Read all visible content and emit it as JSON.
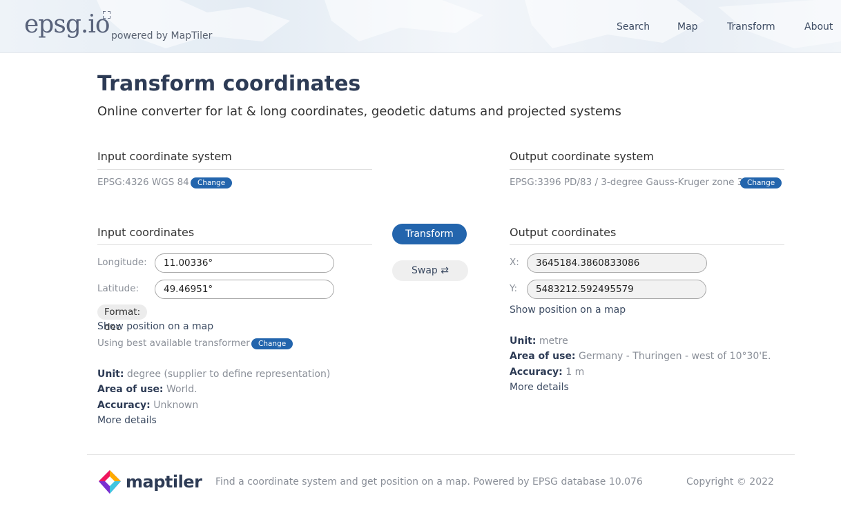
{
  "header": {
    "logo_text": "epsg.io",
    "powered_by": "powered by MapTiler",
    "nav": [
      "Search",
      "Map",
      "Transform",
      "About"
    ]
  },
  "main": {
    "title": "Transform coordinates",
    "subtitle": "Online converter for lat & long coordinates, geodetic datums and projected systems"
  },
  "input_system": {
    "heading": "Input coordinate system",
    "value": "EPSG:4326 WGS 84",
    "change_label": "Change"
  },
  "output_system": {
    "heading": "Output coordinate system",
    "value": "EPSG:3396 PD/83 / 3-degree Gauss-Kruger zone 3",
    "change_label": "Change"
  },
  "input_coords": {
    "heading": "Input coordinates",
    "longitude_label": "Longitude:",
    "longitude_value": "11.00336°",
    "latitude_label": "Latitude:",
    "latitude_value": "49.46951°",
    "format": "Format: dec",
    "show_map": "Show position on a map",
    "transformer": "Using best available transformer",
    "change_label": "Change",
    "unit_label": "Unit:",
    "unit_value": "degree (supplier to define representation)",
    "area_label": "Area of use:",
    "area_value": "World.",
    "accuracy_label": "Accuracy:",
    "accuracy_value": "Unknown",
    "more_details": "More details"
  },
  "actions": {
    "transform": "Transform",
    "swap": "Swap ⇄"
  },
  "output_coords": {
    "heading": "Output coordinates",
    "x_label": "X:",
    "x_value": "3645184.3860833086",
    "y_label": "Y:",
    "y_value": "5483212.592495579",
    "show_map": "Show position on a map",
    "unit_label": "Unit:",
    "unit_value": "metre",
    "area_label": "Area of use:",
    "area_value": "Germany - Thuringen - west of 10°30'E.",
    "accuracy_label": "Accuracy:",
    "accuracy_value": "1 m",
    "more_details": "More details"
  },
  "footer": {
    "brand": "maptiler",
    "text": "Find a coordinate system and get position on a map. Powered by EPSG database 10.076",
    "copyright": "Copyright © 2022"
  },
  "colors": {
    "accent": "#2365ad",
    "title": "#2d3b55",
    "muted": "#8a8f98"
  }
}
